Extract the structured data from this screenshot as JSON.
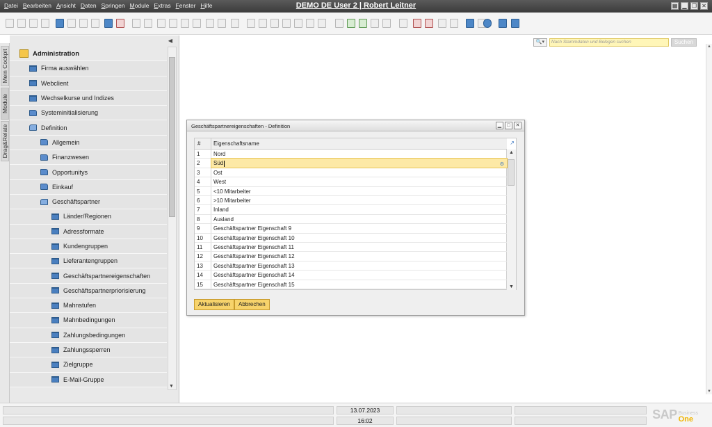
{
  "window": {
    "title": "DEMO DE User 2 | Robert Leitner",
    "menu": [
      "Datei",
      "Bearbeiten",
      "Ansicht",
      "Daten",
      "Springen",
      "Module",
      "Extras",
      "Fenster",
      "Hilfe"
    ]
  },
  "side_tabs": [
    "Mein Cockpit",
    "Module",
    "Drag&Relate"
  ],
  "tree": {
    "root": "Administration",
    "items": [
      {
        "label": "Firma auswählen",
        "level": 1,
        "icon": "page"
      },
      {
        "label": "Webclient",
        "level": 1,
        "icon": "page"
      },
      {
        "label": "Wechselkurse und Indizes",
        "level": 1,
        "icon": "page"
      },
      {
        "label": "Systeminitialisierung",
        "level": 1,
        "icon": "folder"
      },
      {
        "label": "Definition",
        "level": 1,
        "icon": "folder-open"
      },
      {
        "label": "Allgemein",
        "level": 2,
        "icon": "folder"
      },
      {
        "label": "Finanzwesen",
        "level": 2,
        "icon": "folder"
      },
      {
        "label": "Opportunitys",
        "level": 2,
        "icon": "folder"
      },
      {
        "label": "Einkauf",
        "level": 2,
        "icon": "folder"
      },
      {
        "label": "Geschäftspartner",
        "level": 2,
        "icon": "folder-open"
      },
      {
        "label": "Länder/Regionen",
        "level": 3,
        "icon": "page"
      },
      {
        "label": "Adressformate",
        "level": 3,
        "icon": "page"
      },
      {
        "label": "Kundengruppen",
        "level": 3,
        "icon": "page"
      },
      {
        "label": "Lieferantengruppen",
        "level": 3,
        "icon": "page"
      },
      {
        "label": "Geschäftspartnereigenschaften",
        "level": 3,
        "icon": "page"
      },
      {
        "label": "Geschäftspartnerpriorisierung",
        "level": 3,
        "icon": "page"
      },
      {
        "label": "Mahnstufen",
        "level": 3,
        "icon": "page"
      },
      {
        "label": "Mahnbedingungen",
        "level": 3,
        "icon": "page"
      },
      {
        "label": "Zahlungsbedingungen",
        "level": 3,
        "icon": "page"
      },
      {
        "label": "Zahlungssperren",
        "level": 3,
        "icon": "page"
      },
      {
        "label": "Zielgruppe",
        "level": 3,
        "icon": "page"
      },
      {
        "label": "E-Mail-Gruppe",
        "level": 3,
        "icon": "page"
      }
    ]
  },
  "search": {
    "placeholder": "Nach Stammdaten und Belegen suchen",
    "button": "Suchen"
  },
  "dialog": {
    "title": "Geschäftspartnereigenschaften - Definition",
    "columns": [
      "#",
      "Eigenschaftsname"
    ],
    "rows": [
      {
        "num": "1",
        "name": "Nord"
      },
      {
        "num": "2",
        "name": "Süd"
      },
      {
        "num": "3",
        "name": "Ost"
      },
      {
        "num": "4",
        "name": "West"
      },
      {
        "num": "5",
        "name": "<10 Mitarbeiter"
      },
      {
        "num": "6",
        "name": ">10 Mitarbeiter"
      },
      {
        "num": "7",
        "name": "Inland"
      },
      {
        "num": "8",
        "name": "Ausland"
      },
      {
        "num": "9",
        "name": "Geschäftspartner Eigenschaft 9"
      },
      {
        "num": "10",
        "name": "Geschäftspartner Eigenschaft 10"
      },
      {
        "num": "11",
        "name": "Geschäftspartner Eigenschaft 11"
      },
      {
        "num": "12",
        "name": "Geschäftspartner Eigenschaft 12"
      },
      {
        "num": "13",
        "name": "Geschäftspartner Eigenschaft 13"
      },
      {
        "num": "14",
        "name": "Geschäftspartner Eigenschaft 14"
      },
      {
        "num": "15",
        "name": "Geschäftspartner Eigenschaft 15"
      }
    ],
    "selected_row": 1,
    "update_button": "Aktualisieren",
    "cancel_button": "Abbrechen"
  },
  "status": {
    "date": "13.07.2023",
    "time": "16:02"
  },
  "logo": {
    "brand": "SAP",
    "line1": "Business",
    "line2": "One"
  },
  "colors": {
    "selection": "#fde9a6",
    "button": "#f7d36b",
    "search_field": "#fff6b8"
  }
}
